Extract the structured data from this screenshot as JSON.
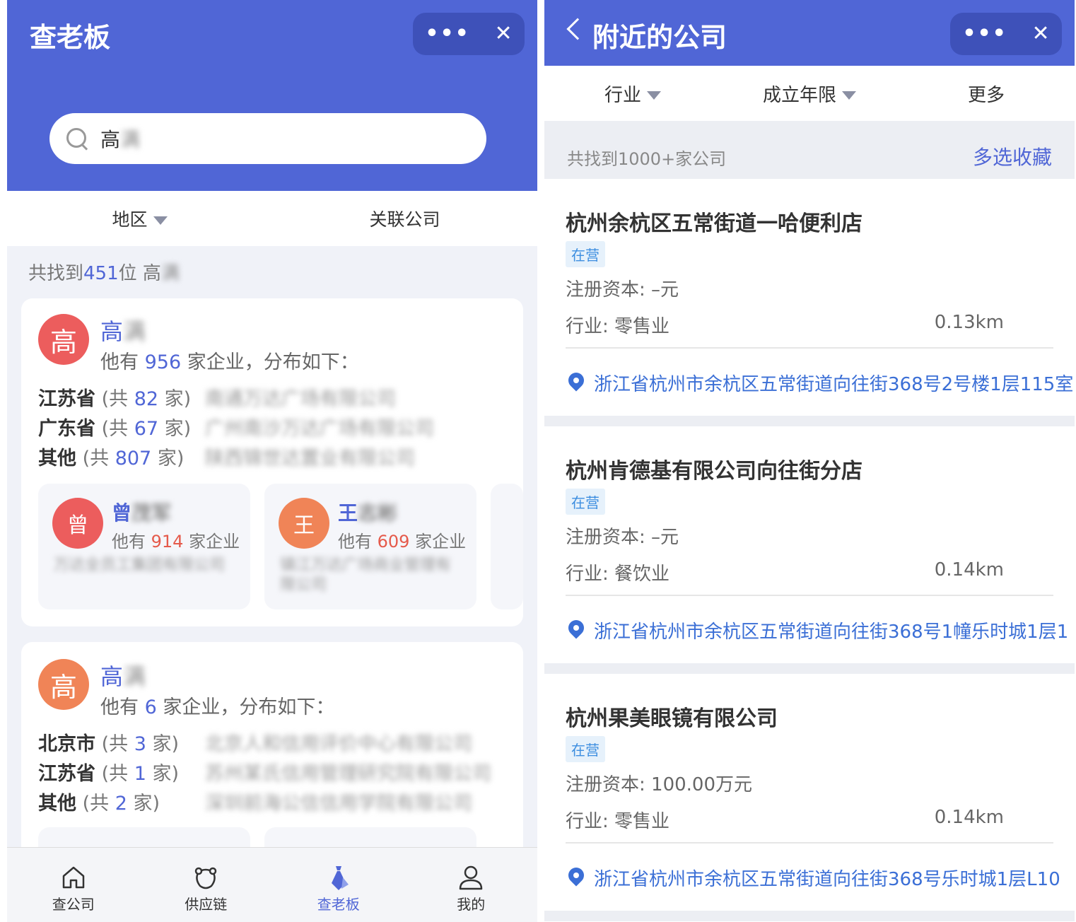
{
  "left": {
    "title": "查老板",
    "capsule": {
      "more": "•••",
      "close": "✕"
    },
    "search": {
      "query": "高",
      "query_hidden": "满"
    },
    "filters": [
      {
        "label": "地区"
      },
      {
        "label": "关联公司"
      }
    ],
    "result": {
      "prefix": "共找到",
      "count": "451",
      "suffix": "位 高",
      "hidden": "满"
    },
    "bosses": [
      {
        "avatar": "高",
        "avatar_color": "#ec5d5d",
        "name": "高",
        "name_hidden": "满",
        "summary_prefix": "他有 ",
        "summary_count": "956",
        "summary_suffix": " 家企业，分布如下：",
        "regions": [
          {
            "name": "江苏省",
            "pre": " (共 ",
            "count": "82",
            "post": " 家)",
            "company": "南通万达广场有限公司"
          },
          {
            "name": "广东省",
            "pre": " (共 ",
            "count": "67",
            "post": " 家)",
            "company": "广州南沙万达广场有限公司"
          },
          {
            "name": "其他",
            "pre": " (共 ",
            "count": "807",
            "post": " 家)",
            "company": "陕西锦世达置业有限公司"
          }
        ],
        "related": [
          {
            "avatar": "曾",
            "avatar_color": "#ec5d5d",
            "name": "曾",
            "name_hidden": "茂军",
            "pre": "他有 ",
            "count": "914",
            "post": " 家企业",
            "company": "万达全员工集团有限公司"
          },
          {
            "avatar": "王",
            "avatar_color": "#f08457",
            "name": "王",
            "name_hidden": "志彬",
            "pre": "他有 ",
            "count": "609",
            "post": " 家企业",
            "company": "镇江万达广场商业管理有限公司"
          }
        ]
      },
      {
        "avatar": "高",
        "avatar_color": "#f08457",
        "name": "高",
        "name_hidden": "满",
        "summary_prefix": "他有 ",
        "summary_count": "6",
        "summary_suffix": " 家企业，分布如下：",
        "regions": [
          {
            "name": "北京市",
            "pre": " (共 ",
            "count": "3",
            "post": " 家)",
            "company": "北京人和信用评价中心有限公司"
          },
          {
            "name": "江苏省",
            "pre": " (共 ",
            "count": "1",
            "post": " 家)",
            "company": "苏州某氏信用管理研究院有限公司"
          },
          {
            "name": "其他",
            "pre": " (共 ",
            "count": "2",
            "post": " 家)",
            "company": "深圳前海公信信用学院有限公司"
          }
        ]
      }
    ],
    "tabs": [
      {
        "label": "查公司",
        "icon": "home-icon"
      },
      {
        "label": "供应链",
        "icon": "supply-chain-icon"
      },
      {
        "label": "查老板",
        "icon": "tie-icon"
      },
      {
        "label": "我的",
        "icon": "user-icon"
      }
    ]
  },
  "right": {
    "title": "附近的公司",
    "capsule": {
      "more": "•••",
      "close": "✕"
    },
    "filters": [
      {
        "label": "行业"
      },
      {
        "label": "成立年限"
      },
      {
        "label": "更多"
      }
    ],
    "result": {
      "text": "共找到1000+家公司",
      "action": "多选收藏"
    },
    "companies": [
      {
        "name": "杭州余杭区五常街道一哈便利店",
        "status": "在营",
        "capital": "注册资本: –元",
        "industry": "行业: 零售业",
        "distance": "0.13km",
        "address": "浙江省杭州市余杭区五常街道向往街368号2号楼1层115室"
      },
      {
        "name": "杭州肯德基有限公司向往街分店",
        "status": "在营",
        "capital": "注册资本: –元",
        "industry": "行业: 餐饮业",
        "distance": "0.14km",
        "address": "浙江省杭州市余杭区五常街道向往街368号1幢乐时城1层1"
      },
      {
        "name": "杭州果美眼镜有限公司",
        "status": "在营",
        "capital": "注册资本: 100.00万元",
        "industry": "行业: 零售业",
        "distance": "0.14km",
        "address": "浙江省杭州市余杭区五常街道向往街368号乐时城1层L10"
      }
    ]
  }
}
